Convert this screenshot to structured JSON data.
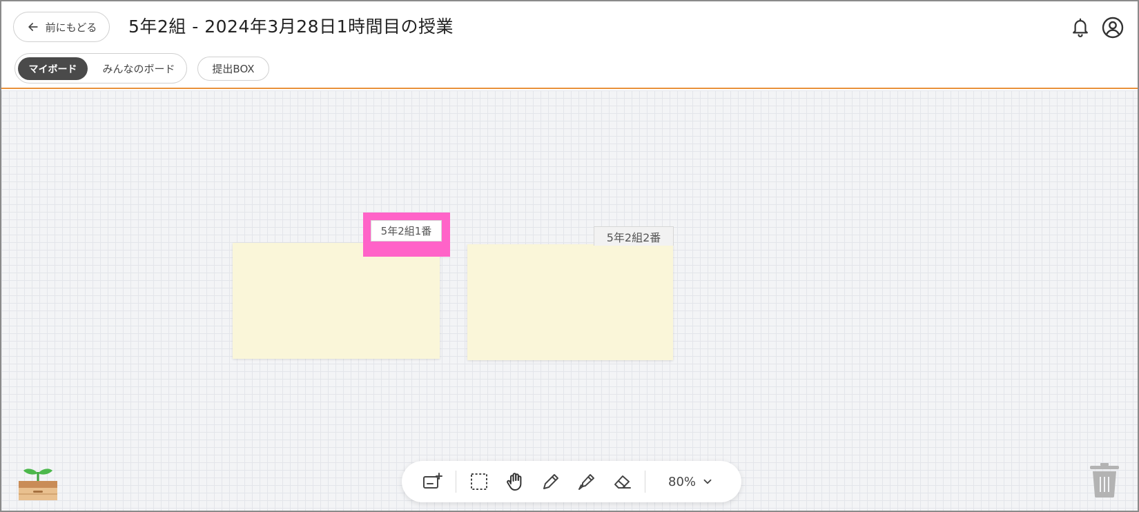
{
  "header": {
    "back_label": "前にもどる",
    "title": "5年2組 - 2024年3月28日1時間目の授業",
    "icons": [
      "arrow-left-icon",
      "bell-icon",
      "account-icon"
    ]
  },
  "tabs": {
    "my_board": "マイボード",
    "everyone_board": "みんなのボード",
    "submit_box": "提出BOX"
  },
  "cards": [
    {
      "label": "5年2組1番",
      "highlighted": true
    },
    {
      "label": "5年2組2番",
      "highlighted": false
    }
  ],
  "toolbar": {
    "tools": [
      "add-card-icon",
      "select-icon",
      "hand-icon",
      "pen-icon",
      "marker-icon",
      "eraser-icon"
    ],
    "zoom_label": "80%"
  },
  "colors": {
    "accent": "#e8903a",
    "highlight": "#ff63c8",
    "card": "#faf6d9",
    "active_tab": "#4a4a4a"
  }
}
